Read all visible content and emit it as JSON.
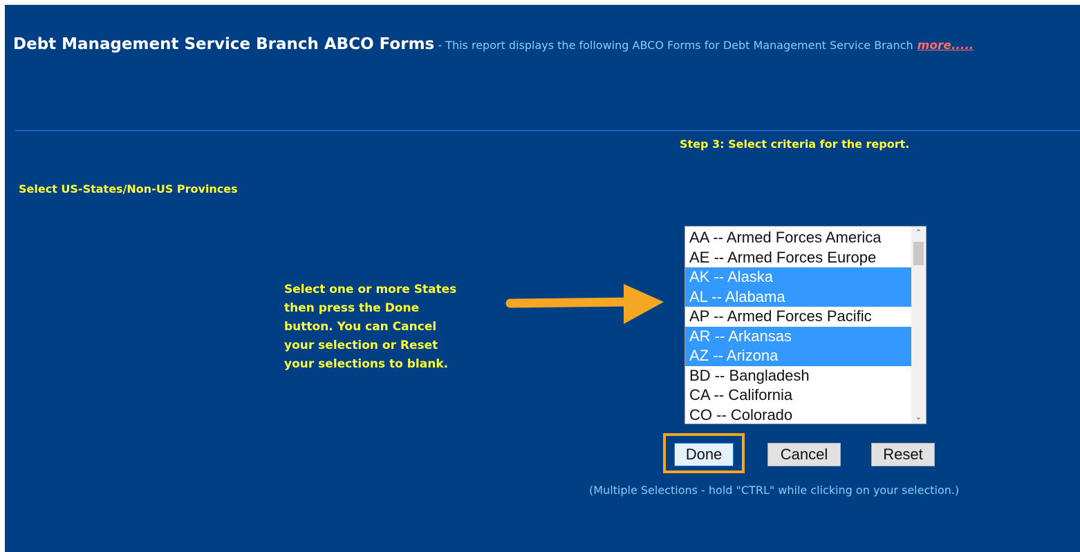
{
  "header": {
    "title": "Debt Management Service Branch ABCO Forms",
    "description": " - This report displays the following ABCO Forms for Debt Management Service Branch",
    "more_link": "more....."
  },
  "step_text": "Step 3: Select criteria for the report.",
  "section_label": "Select US-States/Non-US Provinces",
  "instruction": "Select one or more States\nthen press the Done\nbutton. You can Cancel\nyour selection or Reset\nyour selections to blank.",
  "listbox": {
    "options": [
      {
        "label": "AA -- Armed Forces America",
        "selected": false
      },
      {
        "label": "AE -- Armed Forces Europe",
        "selected": false
      },
      {
        "label": "AK -- Alaska",
        "selected": true
      },
      {
        "label": "AL -- Alabama",
        "selected": true
      },
      {
        "label": "AP -- Armed Forces Pacific",
        "selected": false
      },
      {
        "label": "AR -- Arkansas",
        "selected": true
      },
      {
        "label": "AZ -- Arizona",
        "selected": true
      },
      {
        "label": "BD -- Bangladesh",
        "selected": false
      },
      {
        "label": "CA -- California",
        "selected": false
      },
      {
        "label": "CO -- Colorado",
        "selected": false
      }
    ]
  },
  "buttons": {
    "done": "Done",
    "cancel": "Cancel",
    "reset": "Reset"
  },
  "hint": "(Multiple Selections - hold \"CTRL\" while clicking on your selection.)",
  "colors": {
    "background": "#003f83",
    "highlight_text": "#ffff33",
    "info_text": "#7fd0ff",
    "selected_option": "#3399ff",
    "callout": "#f5a623"
  },
  "icons": {
    "arrow": "arrow-right-icon",
    "scroll_up": "chevron-up-icon",
    "scroll_down": "chevron-down-icon"
  }
}
